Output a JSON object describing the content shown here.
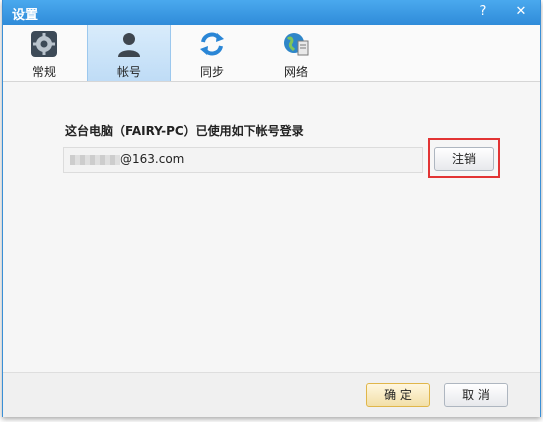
{
  "window": {
    "title": "设置"
  },
  "titlebar": {
    "help_label": "?",
    "close_label": "✕"
  },
  "tabs": [
    {
      "label": "常规",
      "icon": "gear-icon"
    },
    {
      "label": "帐号",
      "icon": "user-icon",
      "active": true
    },
    {
      "label": "同步",
      "icon": "sync-icon"
    },
    {
      "label": "网络",
      "icon": "network-icon"
    }
  ],
  "account": {
    "prompt": "这台电脑（FAIRY-PC）已使用如下帐号登录",
    "email_visible_part": "@163.com",
    "logout_label": "注销"
  },
  "footer": {
    "ok_label": "确 定",
    "cancel_label": "取 消"
  },
  "colors": {
    "titlebar": "#2f8bd9",
    "highlight": "#e23434"
  }
}
